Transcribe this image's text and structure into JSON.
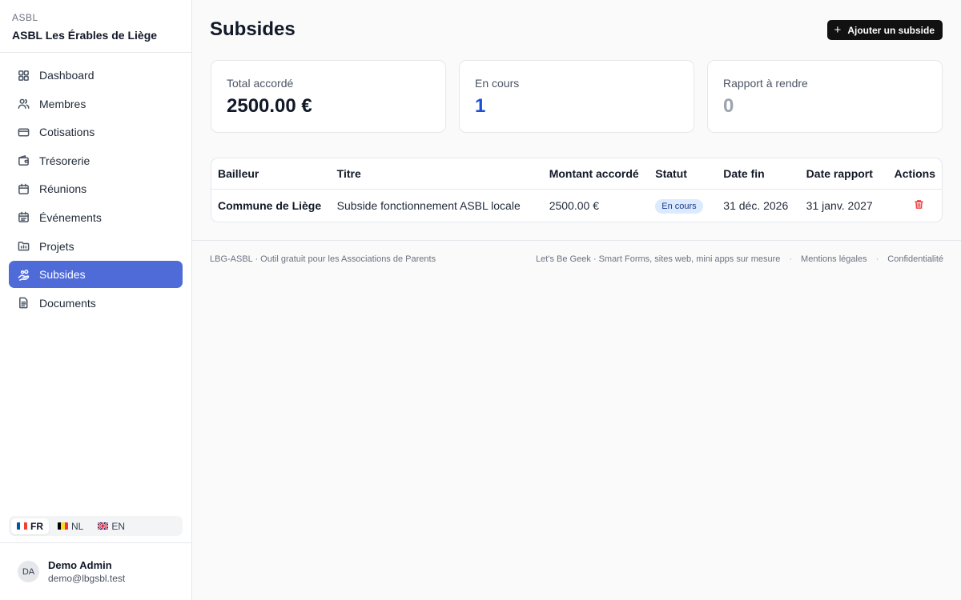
{
  "org": {
    "type": "ASBL",
    "name": "ASBL Les Érables de Liège"
  },
  "sidebar": {
    "items": [
      {
        "label": "Dashboard",
        "icon": "dashboard-icon",
        "active": false
      },
      {
        "label": "Membres",
        "icon": "users-icon",
        "active": false
      },
      {
        "label": "Cotisations",
        "icon": "credit-card-icon",
        "active": false
      },
      {
        "label": "Trésorerie",
        "icon": "wallet-icon",
        "active": false
      },
      {
        "label": "Réunions",
        "icon": "calendar-icon",
        "active": false
      },
      {
        "label": "Événements",
        "icon": "calendar-event-icon",
        "active": false
      },
      {
        "label": "Projets",
        "icon": "folder-icon",
        "active": false
      },
      {
        "label": "Subsides",
        "icon": "hand-coins-icon",
        "active": true
      },
      {
        "label": "Documents",
        "icon": "document-icon",
        "active": false
      }
    ]
  },
  "languages": [
    {
      "code": "FR",
      "active": true,
      "flag": [
        "#0055a4",
        "#ffffff",
        "#ef4135"
      ]
    },
    {
      "code": "NL",
      "active": false,
      "flag": [
        "#000000",
        "#fdda24",
        "#ef3340"
      ]
    },
    {
      "code": "EN",
      "active": false,
      "flag": [
        "#012169",
        "#ffffff",
        "#c8102e"
      ]
    }
  ],
  "user": {
    "initials": "DA",
    "name": "Demo Admin",
    "email": "demo@lbgsbl.test"
  },
  "main": {
    "title": "Subsides",
    "add_button": "Ajouter un subside"
  },
  "stats": [
    {
      "label": "Total accordé",
      "value": "2500.00 €",
      "color": "#111827"
    },
    {
      "label": "En cours",
      "value": "1",
      "color": "#1d4ed8"
    },
    {
      "label": "Rapport à rendre",
      "value": "0",
      "color": "#9ca3af"
    }
  ],
  "table": {
    "headers": [
      "Bailleur",
      "Titre",
      "Montant accordé",
      "Statut",
      "Date fin",
      "Date rapport",
      "Actions"
    ],
    "rows": [
      {
        "bailleur": "Commune de Liège",
        "titre": "Subside fonctionnement ASBL locale",
        "montant": "2500.00 €",
        "statut": "En cours",
        "date_fin": "31 déc. 2026",
        "date_rapport": "31 janv. 2027"
      }
    ]
  },
  "footer": {
    "left": "LBG-ASBL · Outil gratuit pour les Associations de Parents",
    "links": [
      "Let's Be Geek · Smart Forms, sites web, mini apps sur mesure",
      "Mentions légales",
      "Confidentialité"
    ]
  },
  "colors": {
    "accent": "#4f6bd8",
    "danger": "#ef4444",
    "badge_bg": "#dbeafe"
  }
}
